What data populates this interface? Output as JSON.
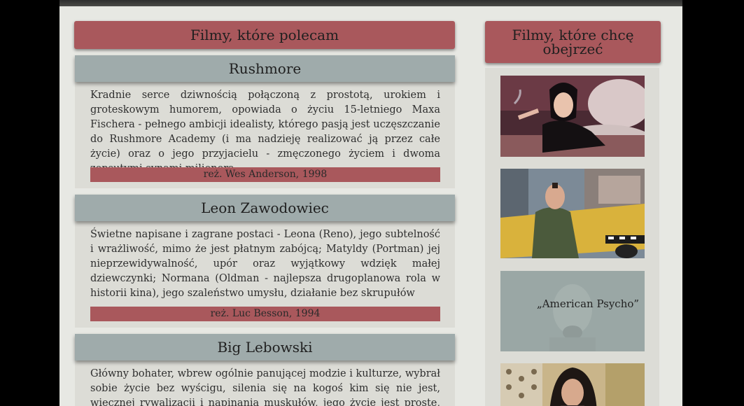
{
  "main": {
    "heading": "Filmy, które polecam",
    "films": [
      {
        "title": "Rushmore",
        "description": "Kradnie serce dziwnością połączoną z prostotą, urokiem i groteskowym humorem, opowiada o życiu 15-letniego Maxa Fischera - pełnego ambicji idealisty, którego pasją jest uczęszczanie do Rushmore Academy (i ma nadzieję realizować ją przez całe życie) oraz o jego przyjacielu - zmęczonego życiem i dwoma zepsutymi synami milionera.",
        "meta": "reż. Wes Anderson, 1998"
      },
      {
        "title": "Leon Zawodowiec",
        "description": "Świetne napisane i zagrane postaci - Leona (Reno), jego subtelność i wrażliwość, mimo że jest płatnym zabójcą; Matyldy (Portman) jej nieprzewidywalność, upór oraz wyjątkowy wdzięk małej dziewczynki; Normana (Oldman - najlepsza drugoplanowa rola w historii kina), jego szaleństwo umysłu, działanie bez skrupułów",
        "meta": "reż. Luc Besson, 1994"
      },
      {
        "title": "Big Lebowski",
        "description": "Główny bohater, wbrew ogólnie panującej modzie i kulturze, wybrał sobie życie bez wyścigu, silenia się na kogoś kim się nie jest, wiecznej rywalizacji i napinania muskułów, jego życie jest proste, pozbawione luksusów, ale",
        "meta": ""
      }
    ]
  },
  "sidebar": {
    "heading": "Filmy, które chcę obejrzeć",
    "items": [
      {
        "caption": "",
        "icon": "woman-on-bed-photo"
      },
      {
        "caption": "",
        "icon": "man-by-taxi-photo"
      },
      {
        "caption": "„American Psycho”",
        "icon": "screaming-face-photo"
      },
      {
        "caption": "",
        "icon": "girl-portrait-photo"
      }
    ]
  },
  "colors": {
    "accent": "#a9585c",
    "card_title_bg": "#9fabab",
    "card_bg": "#dcdcd6",
    "page_bg": "#e7e8e3"
  }
}
